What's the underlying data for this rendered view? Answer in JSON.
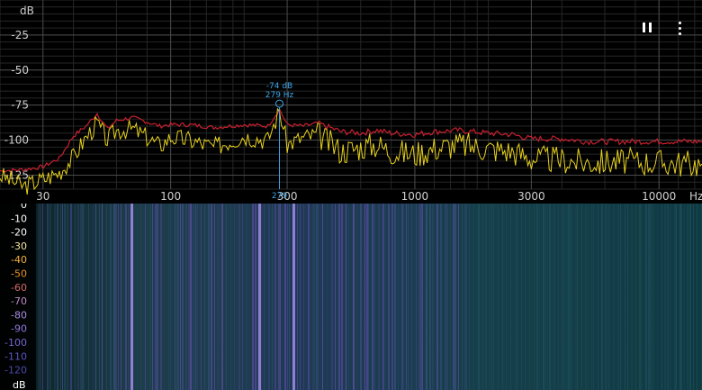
{
  "toolbar": {
    "pause_icon": "pause-icon",
    "more_icon": "more-vert-icon"
  },
  "colors": {
    "background": "#000000",
    "grid_major": "#4a4a4a",
    "grid_minor": "#262626",
    "peak_hold": "#c8202f",
    "live": "#e8d21c",
    "peak_marker": "#3aa6e8"
  },
  "chart_data": [
    {
      "type": "line",
      "xscale": "log",
      "xlabel": "Hz",
      "ylabel": "dB",
      "xlim": [
        20,
        15000
      ],
      "ylim": [
        -135,
        0
      ],
      "grid": true,
      "x_ticks": [
        "30",
        "100",
        "300",
        "1000",
        "3000",
        "10000"
      ],
      "y_ticks": [
        "-25",
        "-50",
        "-75",
        "-100",
        "-125"
      ],
      "peak_marker": {
        "label_db": "-74 dB",
        "label_hz": "279 Hz",
        "x": 279,
        "y": -74,
        "cursor_label": "279"
      },
      "series": [
        {
          "x": [
            20,
            25,
            30,
            35,
            40,
            45,
            50,
            55,
            60,
            70,
            80,
            90,
            100,
            120,
            150,
            200,
            250,
            279,
            300,
            350,
            400,
            500,
            600,
            700,
            800,
            1000,
            1200,
            1500,
            2000,
            2500,
            3000,
            4000,
            5000,
            7000,
            10000,
            15000
          ],
          "y": [
            -122,
            -121,
            -119,
            -113,
            -97,
            -90,
            -81,
            -92,
            -86,
            -84,
            -87,
            -90,
            -89,
            -89,
            -91,
            -89,
            -90,
            -78,
            -89,
            -90,
            -88,
            -94,
            -95,
            -93,
            -95,
            -96,
            -94,
            -93,
            -95,
            -96,
            -99,
            -99,
            -101,
            -101,
            -101,
            -101
          ]
        },
        {
          "x": [
            20,
            25,
            30,
            35,
            40,
            45,
            50,
            55,
            60,
            70,
            80,
            90,
            100,
            120,
            150,
            200,
            250,
            279,
            300,
            350,
            400,
            500,
            600,
            700,
            800,
            1000,
            1200,
            1500,
            2000,
            2500,
            3000,
            4000,
            5000,
            7000,
            10000,
            15000
          ],
          "y": [
            -125,
            -133,
            -128,
            -123,
            -112,
            -98,
            -88,
            -100,
            -93,
            -92,
            -98,
            -104,
            -98,
            -100,
            -105,
            -97,
            -100,
            -79,
            -103,
            -98,
            -96,
            -108,
            -105,
            -103,
            -108,
            -110,
            -106,
            -103,
            -106,
            -108,
            -113,
            -114,
            -116,
            -115,
            -116,
            -117
          ]
        }
      ]
    },
    {
      "type": "heatmap",
      "ylabel": "dB",
      "legend_ticks": [
        "0",
        "-10",
        "-20",
        "-30",
        "-40",
        "-50",
        "-60",
        "-70",
        "-80",
        "-90",
        "-100",
        "-110",
        "-120"
      ],
      "legend_colors": [
        "#ffffff",
        "#ffffff",
        "#ffffff",
        "#f3e6a0",
        "#f6b23a",
        "#e8902a",
        "#d46a6a",
        "#c08ac8",
        "#a98be0",
        "#9178dc",
        "#7665d4",
        "#5a55c4",
        "#4b4aa8"
      ]
    }
  ]
}
